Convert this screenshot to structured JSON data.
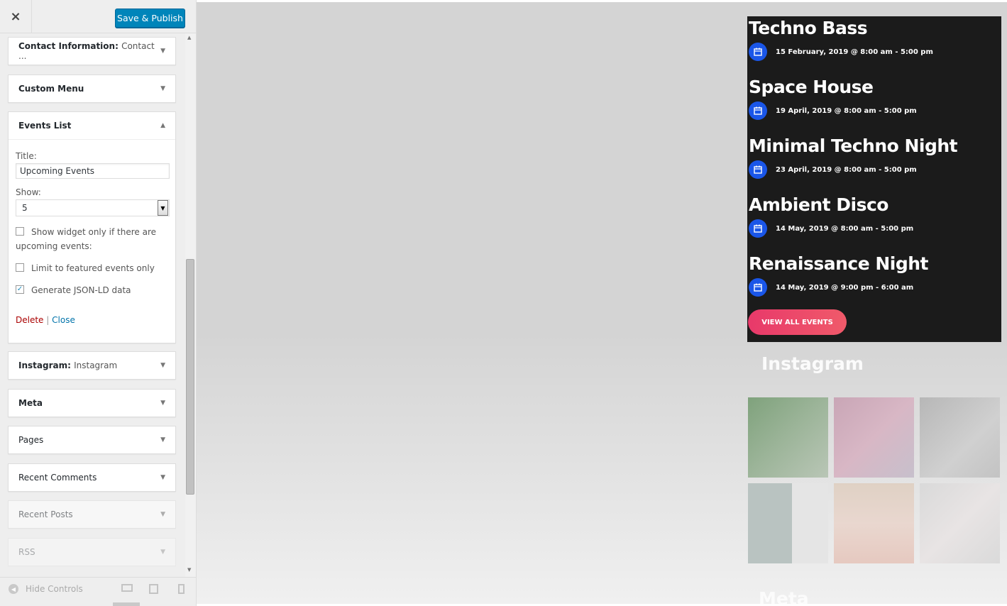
{
  "header": {
    "close_icon": "×",
    "publish_label": "Save & Publish"
  },
  "sections": {
    "contact": {
      "label": "Contact Information:",
      "sub": "Contact ..."
    },
    "custom_menu": {
      "label": "Custom Menu"
    },
    "events_list": {
      "label": "Events List",
      "title_label": "Title:",
      "title_value": "Upcoming Events",
      "show_label": "Show:",
      "show_value": "5",
      "opt_upcoming": "Show widget only if there are upcoming events:",
      "opt_upcoming_checked": false,
      "opt_featured": "Limit to featured events only",
      "opt_featured_checked": false,
      "opt_jsonld": "Generate JSON-LD data",
      "opt_jsonld_checked": true,
      "delete_label": "Delete",
      "separator": "|",
      "close_label": "Close"
    },
    "instagram": {
      "label": "Instagram:",
      "sub": "Instagram"
    },
    "meta": {
      "label": "Meta"
    },
    "pages": {
      "label": "Pages"
    },
    "recent_comments": {
      "label": "Recent Comments"
    },
    "recent_posts": {
      "label": "Recent Posts"
    },
    "rss": {
      "label": "RSS"
    }
  },
  "footer": {
    "hide_controls": "Hide Controls"
  },
  "preview": {
    "events": [
      {
        "title": "Techno Bass",
        "date": "15 February, 2019 @ 8:00 am - 5:00 pm"
      },
      {
        "title": "Space House",
        "date": "19 April, 2019 @ 8:00 am - 5:00 pm"
      },
      {
        "title": "Minimal Techno Night",
        "date": "23 April, 2019 @ 8:00 am - 5:00 pm"
      },
      {
        "title": "Ambient Disco",
        "date": "14 May, 2019 @ 8:00 am - 5:00 pm"
      },
      {
        "title": "Renaissance Night",
        "date": "14 May, 2019 @ 9:00 pm - 6:00 am"
      }
    ],
    "view_all": "VIEW ALL EVENTS",
    "instagram_title": "Instagram",
    "meta_title": "Meta",
    "accent_color": "#1a56e8",
    "button_color": "#e8396a"
  }
}
